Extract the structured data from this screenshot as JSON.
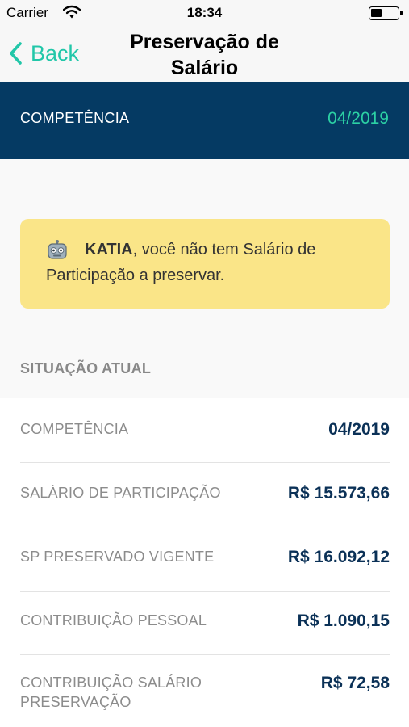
{
  "status_bar": {
    "carrier": "Carrier",
    "time": "18:34"
  },
  "nav": {
    "back_label": "Back",
    "title_line1": "Preservação de",
    "title_line2": "Salário"
  },
  "competencia_banner": {
    "label": "COMPETÊNCIA",
    "value": "04/2019"
  },
  "notice": {
    "name": "KATIA",
    "message": ", você não tem Salário de Participação a preservar."
  },
  "situacao": {
    "title": "SITUAÇÃO ATUAL",
    "rows": [
      {
        "label": "COMPETÊNCIA",
        "value": "04/2019"
      },
      {
        "label": "SALÁRIO DE PARTICIPAÇÃO",
        "value": "R$ 15.573,66"
      },
      {
        "label": "SP PRESERVADO VIGENTE",
        "value": "R$ 16.092,12"
      },
      {
        "label": "CONTRIBUIÇÃO PESSOAL",
        "value": "R$ 1.090,15"
      },
      {
        "label_line1": "CONTRIBUIÇÃO SALÁRIO",
        "label_line2": "PRESERVAÇÃO",
        "value": "R$ 72,58"
      }
    ]
  },
  "colors": {
    "nav_accent": "#22c7a9",
    "banner_bg": "#053a63",
    "banner_value": "#2cd1a4",
    "notice_bg": "#fae588",
    "value_text": "#0b3157"
  },
  "icons": [
    "wifi-icon",
    "battery-icon",
    "back-chevron-icon",
    "robot-icon"
  ]
}
